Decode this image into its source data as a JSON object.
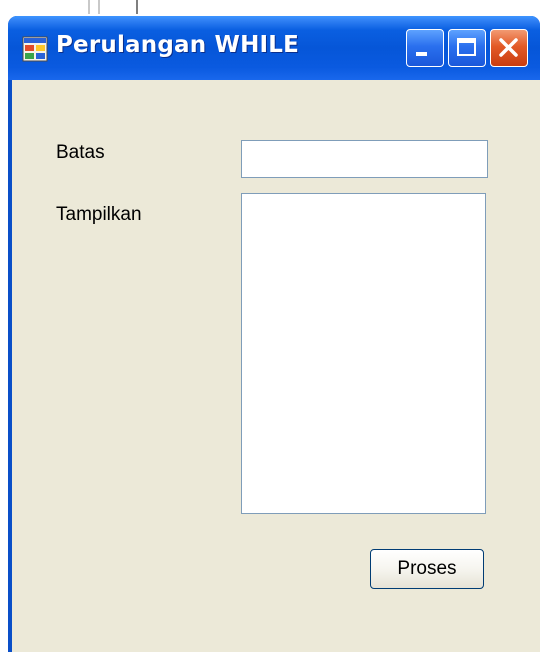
{
  "window": {
    "title": "Perulangan WHILE",
    "app_icon": "windows-form-icon",
    "controls": {
      "minimize_icon": "minimize-icon",
      "maximize_icon": "maximize-icon",
      "close_icon": "close-icon"
    }
  },
  "form": {
    "batas_label": "Batas",
    "batas_value": "",
    "tampilkan_label": "Tampilkan",
    "tampilkan_value": "",
    "proses_label": "Proses"
  },
  "colors": {
    "titlebar": "#0a5fe1",
    "client_background": "#ece9d8",
    "close_button": "#e35a27",
    "field_border": "#7f9db9"
  }
}
